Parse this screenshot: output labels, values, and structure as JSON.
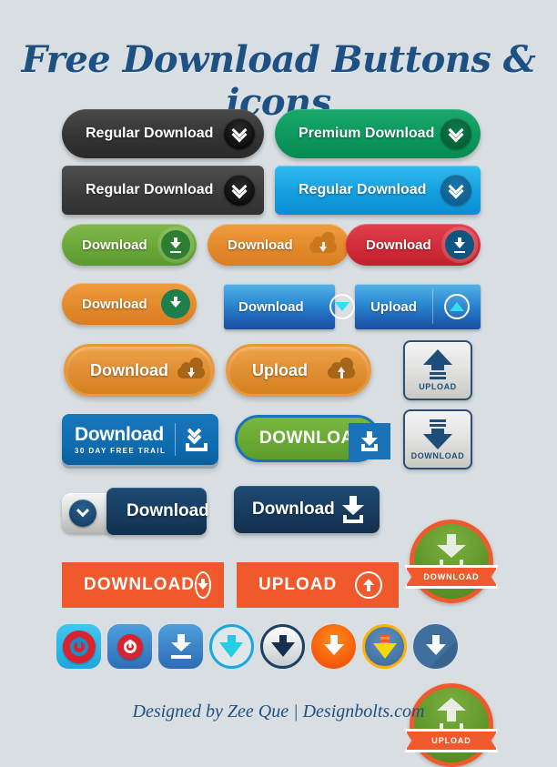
{
  "page": {
    "title": "Free Download Buttons & icons",
    "footer": "Designed by Zee Que | Designbolts.com",
    "background_color": "#d8dee2",
    "title_color": "#1d5083"
  },
  "row1": {
    "regular_dark": {
      "label": "Regular Download",
      "icon": "double-chevron-down-icon",
      "color": "#343434"
    },
    "premium_green": {
      "label": "Premium Download",
      "icon": "double-chevron-down-icon",
      "color": "#0e9a5e"
    }
  },
  "row2": {
    "regular_dark_rect": {
      "label": "Regular Download",
      "icon": "double-chevron-down-icon",
      "color": "#3a3a3a"
    },
    "regular_blue_rect": {
      "label": "Regular Download",
      "icon": "double-chevron-down-icon",
      "color": "#159ede"
    }
  },
  "row3": {
    "green": {
      "label": "Download",
      "icon": "download-arrow-icon",
      "color": "#6aa83a"
    },
    "orange_cloud": {
      "label": "Download",
      "icon": "cloud-download-icon",
      "color": "#e38a2c"
    },
    "red": {
      "label": "Download",
      "icon": "download-arrow-icon",
      "color": "#d02c39"
    }
  },
  "row4": {
    "orange_curved": {
      "label": "Download",
      "icon": "curved-download-arrow-icon",
      "color": "#e38a2c"
    },
    "blue_split_download": {
      "label": "Download",
      "icon": "circle-arrow-down-icon",
      "color": "#2a87d0"
    },
    "blue_split_upload": {
      "label": "Upload",
      "icon": "circle-arrow-up-icon",
      "color": "#2a87d0"
    }
  },
  "row5": {
    "orange_cloud_download": {
      "label": "Download",
      "icon": "cloud-download-icon",
      "color": "#e08f33"
    },
    "orange_cloud_upload": {
      "label": "Upload",
      "icon": "cloud-upload-icon",
      "color": "#e08f33"
    },
    "silver_upload": {
      "label": "UPLOAD",
      "icon": "fat-arrow-up-icon",
      "color": "#e3e4e2"
    }
  },
  "row6": {
    "trial": {
      "label": "Download",
      "sublabel": "30 DAY FREE TRAIL",
      "icon": "double-chevron-down-tray-icon",
      "color": "#0f6cb0"
    },
    "green_download": {
      "label": "DOWNLOAD",
      "icon": "download-tray-icon",
      "color": "#67a834",
      "border_color": "#1a72b8"
    },
    "silver_download": {
      "label": "DOWNLOAD",
      "icon": "fat-arrow-down-icon",
      "color": "#e3e4e2"
    }
  },
  "row7": {
    "navy_side": {
      "label": "Download",
      "icon": "chevron-down-knob-icon",
      "color": "#173c60"
    },
    "navy_download": {
      "label": "Download",
      "icon": "download-tray-icon",
      "color": "#173c60"
    },
    "badge_download": {
      "label": "DOWNLOAD",
      "icon": "download-tray-icon",
      "color": "#4c8421",
      "ribbon_color": "#f0592b"
    }
  },
  "row8": {
    "flat_download": {
      "label": "DOWNLOAD",
      "icon": "circle-arrow-down-icon",
      "color": "#f0592b"
    },
    "flat_upload": {
      "label": "UPLOAD",
      "icon": "circle-arrow-up-icon",
      "color": "#f0592b"
    },
    "badge_upload": {
      "label": "UPLOAD",
      "icon": "upload-tray-icon",
      "color": "#4c8421",
      "ribbon_color": "#f0592b"
    }
  },
  "icons_row": [
    {
      "name": "power-download-cyan-icon",
      "shape": "rounded-square",
      "color": "#1fa6dd"
    },
    {
      "name": "power-download-blue-icon",
      "shape": "rounded-square",
      "color": "#2e6fb8"
    },
    {
      "name": "download-tray-blue-icon",
      "shape": "rounded-square",
      "color": "#2d6cb5"
    },
    {
      "name": "arrow-down-cyan-circle-icon",
      "shape": "circle",
      "color": "#22cfe5"
    },
    {
      "name": "arrow-down-navy-circle-icon",
      "shape": "circle",
      "color": "#15314f"
    },
    {
      "name": "arrow-down-orange-circle-icon",
      "shape": "circle",
      "color": "#f24405"
    },
    {
      "name": "arrow-down-yellow-circle-icon",
      "shape": "circle",
      "color": "#f5d90a"
    },
    {
      "name": "arrow-down-steelblue-circle-icon",
      "shape": "circle",
      "color": "#3f6f9e"
    }
  ]
}
